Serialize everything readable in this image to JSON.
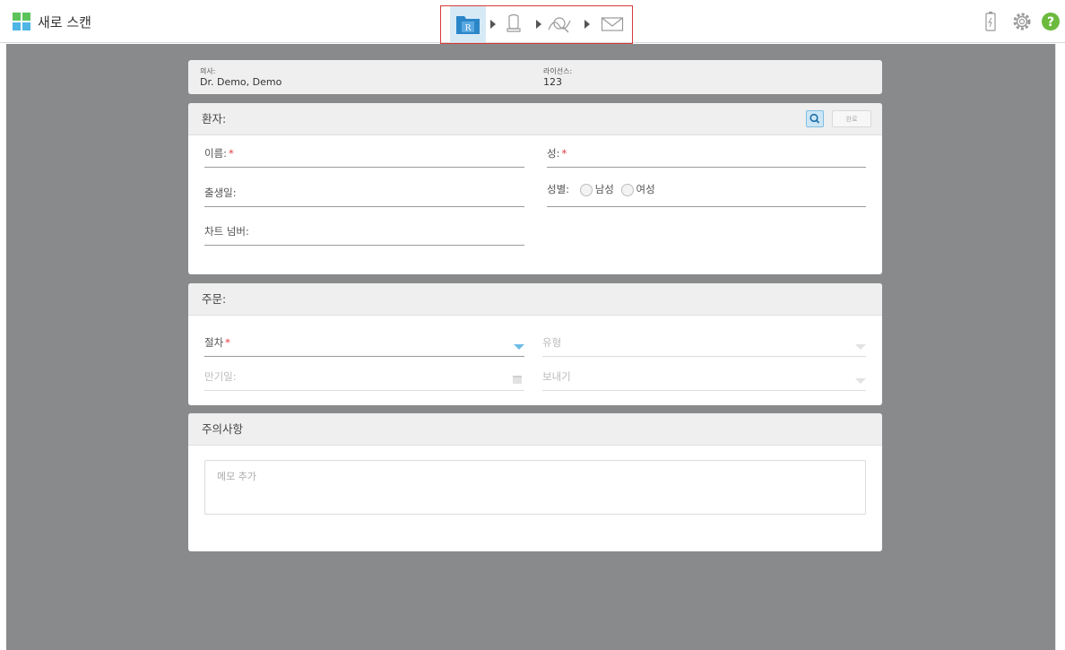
{
  "app": {
    "title": "새로 스캔"
  },
  "workflow": {
    "steps": [
      {
        "icon": "rx-folder-icon",
        "label": "R"
      },
      {
        "icon": "scan-tooth-icon"
      },
      {
        "icon": "view-icon"
      },
      {
        "icon": "send-icon"
      }
    ]
  },
  "header_icons": [
    "battery-icon",
    "settings-gear-icon",
    "help-icon"
  ],
  "doctor": {
    "doctor_label": "의사:",
    "doctor_value": "Dr. Demo, Demo",
    "license_label": "라이선스:",
    "license_value": "123"
  },
  "patient": {
    "title": "환자:",
    "search_button_label": "Q",
    "clear_button_label": "완료",
    "first_name_label": "이름:",
    "last_name_label": "성:",
    "birthdate_label": "출생일:",
    "gender_label": "성별:",
    "gender_male": "남성",
    "gender_female": "여성",
    "chart_number_label": "차트 넘버:",
    "required_marker": "*"
  },
  "order": {
    "title": "주문:",
    "procedure_label": "절차",
    "type_label": "유형",
    "due_date_label": "만기일:",
    "send_to_label": "보내기"
  },
  "notes": {
    "title": "주의사항",
    "placeholder": "메모 추가"
  }
}
